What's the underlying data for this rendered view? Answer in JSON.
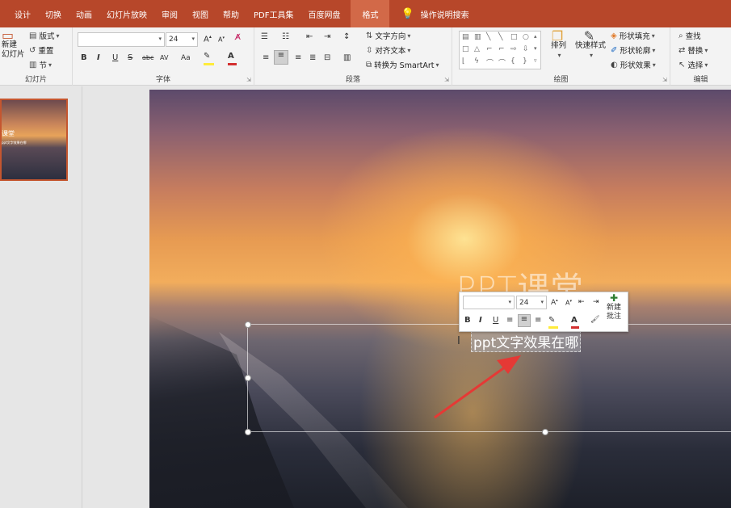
{
  "tabs": [
    "设计",
    "切换",
    "动画",
    "幻灯片放映",
    "审阅",
    "视图",
    "帮助",
    "PDF工具集",
    "百度网盘",
    "格式"
  ],
  "active_tab": "格式",
  "tell_me": "操作说明搜索",
  "ribbon": {
    "slides": {
      "label": "幻灯片",
      "new_slide": "新建\n幻灯片",
      "layout": "版式",
      "reset": "重置",
      "section": "节"
    },
    "font": {
      "label": "字体",
      "font_name": "",
      "font_size": "24",
      "bold": "B",
      "italic": "I",
      "underline": "U",
      "strike": "S",
      "abc": "abc",
      "spacing": "AV",
      "case": "Aa"
    },
    "paragraph": {
      "label": "段落",
      "text_direction": "文字方向",
      "align_text": "对齐文本",
      "convert_smartart": "转换为 SmartArt"
    },
    "drawing": {
      "label": "绘图",
      "arrange": "排列",
      "quick_styles": "快速样式",
      "shape_fill": "形状填充",
      "shape_outline": "形状轮廓",
      "shape_effects": "形状效果"
    },
    "editing": {
      "label": "编辑",
      "find": "查找",
      "replace": "替换",
      "select": "选择"
    }
  },
  "thumbnail": {
    "title": "课堂",
    "subtitle": "ppt文字效果在哪"
  },
  "slide": {
    "title": "PPT课堂",
    "subtitle": "ppt文字效果在哪"
  },
  "mini_toolbar": {
    "font_name": "",
    "font_size": "24",
    "bold": "B",
    "italic": "I",
    "underline": "U",
    "new_comment": "新建\n批注"
  },
  "colors": {
    "tab_bar": "#b7472a",
    "active_tab": "#d26948",
    "arrow": "#e53935",
    "font_color_bar": "#d32f2f",
    "highlight_bar": "#ffeb3b"
  }
}
